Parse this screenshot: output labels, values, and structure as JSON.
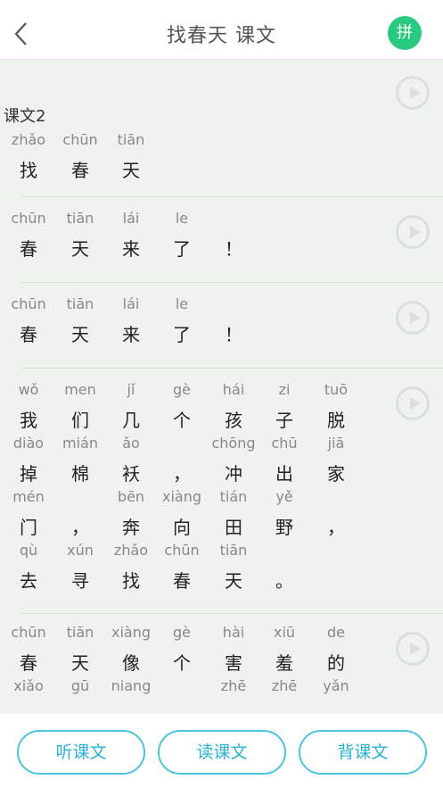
{
  "header": {
    "title": "找春天  课文",
    "pinyin_toggle_label": "拼"
  },
  "lesson_label": "课文2",
  "sections": [
    {
      "lines": [
        {
          "pinyin": [
            "zhǎo",
            "chūn",
            "tiān"
          ],
          "hanzi": [
            "找",
            "春",
            "天"
          ]
        }
      ]
    },
    {
      "lines": [
        {
          "pinyin": [
            "chūn",
            "tiān",
            "lái",
            "le",
            ""
          ],
          "hanzi": [
            "春",
            "天",
            "来",
            "了",
            "！"
          ]
        }
      ]
    },
    {
      "lines": [
        {
          "pinyin": [
            "chūn",
            "tiān",
            "lái",
            "le",
            ""
          ],
          "hanzi": [
            "春",
            "天",
            "来",
            "了",
            "！"
          ]
        }
      ]
    },
    {
      "lines": [
        {
          "pinyin": [
            "wǒ",
            "men",
            "jǐ",
            "gè",
            "hái",
            "zi",
            "tuō"
          ],
          "hanzi": [
            "我",
            "们",
            "几",
            "个",
            "孩",
            "子",
            "脱"
          ]
        },
        {
          "pinyin": [
            "diào",
            "mián",
            "ǎo",
            "",
            "chōng",
            "chū",
            "jiā"
          ],
          "hanzi": [
            "掉",
            "棉",
            "袄",
            "，",
            "冲",
            "出",
            "家"
          ]
        },
        {
          "pinyin": [
            "mén",
            "",
            "bēn",
            "xiàng",
            "tián",
            "yě",
            ""
          ],
          "hanzi": [
            "门",
            "，",
            "奔",
            "向",
            "田",
            "野",
            "，"
          ]
        },
        {
          "pinyin": [
            "qù",
            "xún",
            "zhǎo",
            "chūn",
            "tiān",
            ""
          ],
          "hanzi": [
            "去",
            "寻",
            "找",
            "春",
            "天",
            "。"
          ]
        }
      ]
    },
    {
      "lines": [
        {
          "pinyin": [
            "chūn",
            "tiān",
            "xiàng",
            "gè",
            "hài",
            "xiū",
            "de"
          ],
          "hanzi": [
            "春",
            "天",
            "像",
            "个",
            "害",
            "羞",
            "的"
          ]
        },
        {
          "pinyin": [
            "xiǎo",
            "gū",
            "niang",
            "",
            "zhē",
            "zhē",
            "yǎn"
          ],
          "hanzi": []
        }
      ]
    }
  ],
  "footer": {
    "listen_label": "听课文",
    "read_label": "读课文",
    "recite_label": "背课文"
  },
  "colors": {
    "accent_green": "#29c97f",
    "accent_blue": "#27b3d8",
    "content_bg": "#eef3ee"
  }
}
